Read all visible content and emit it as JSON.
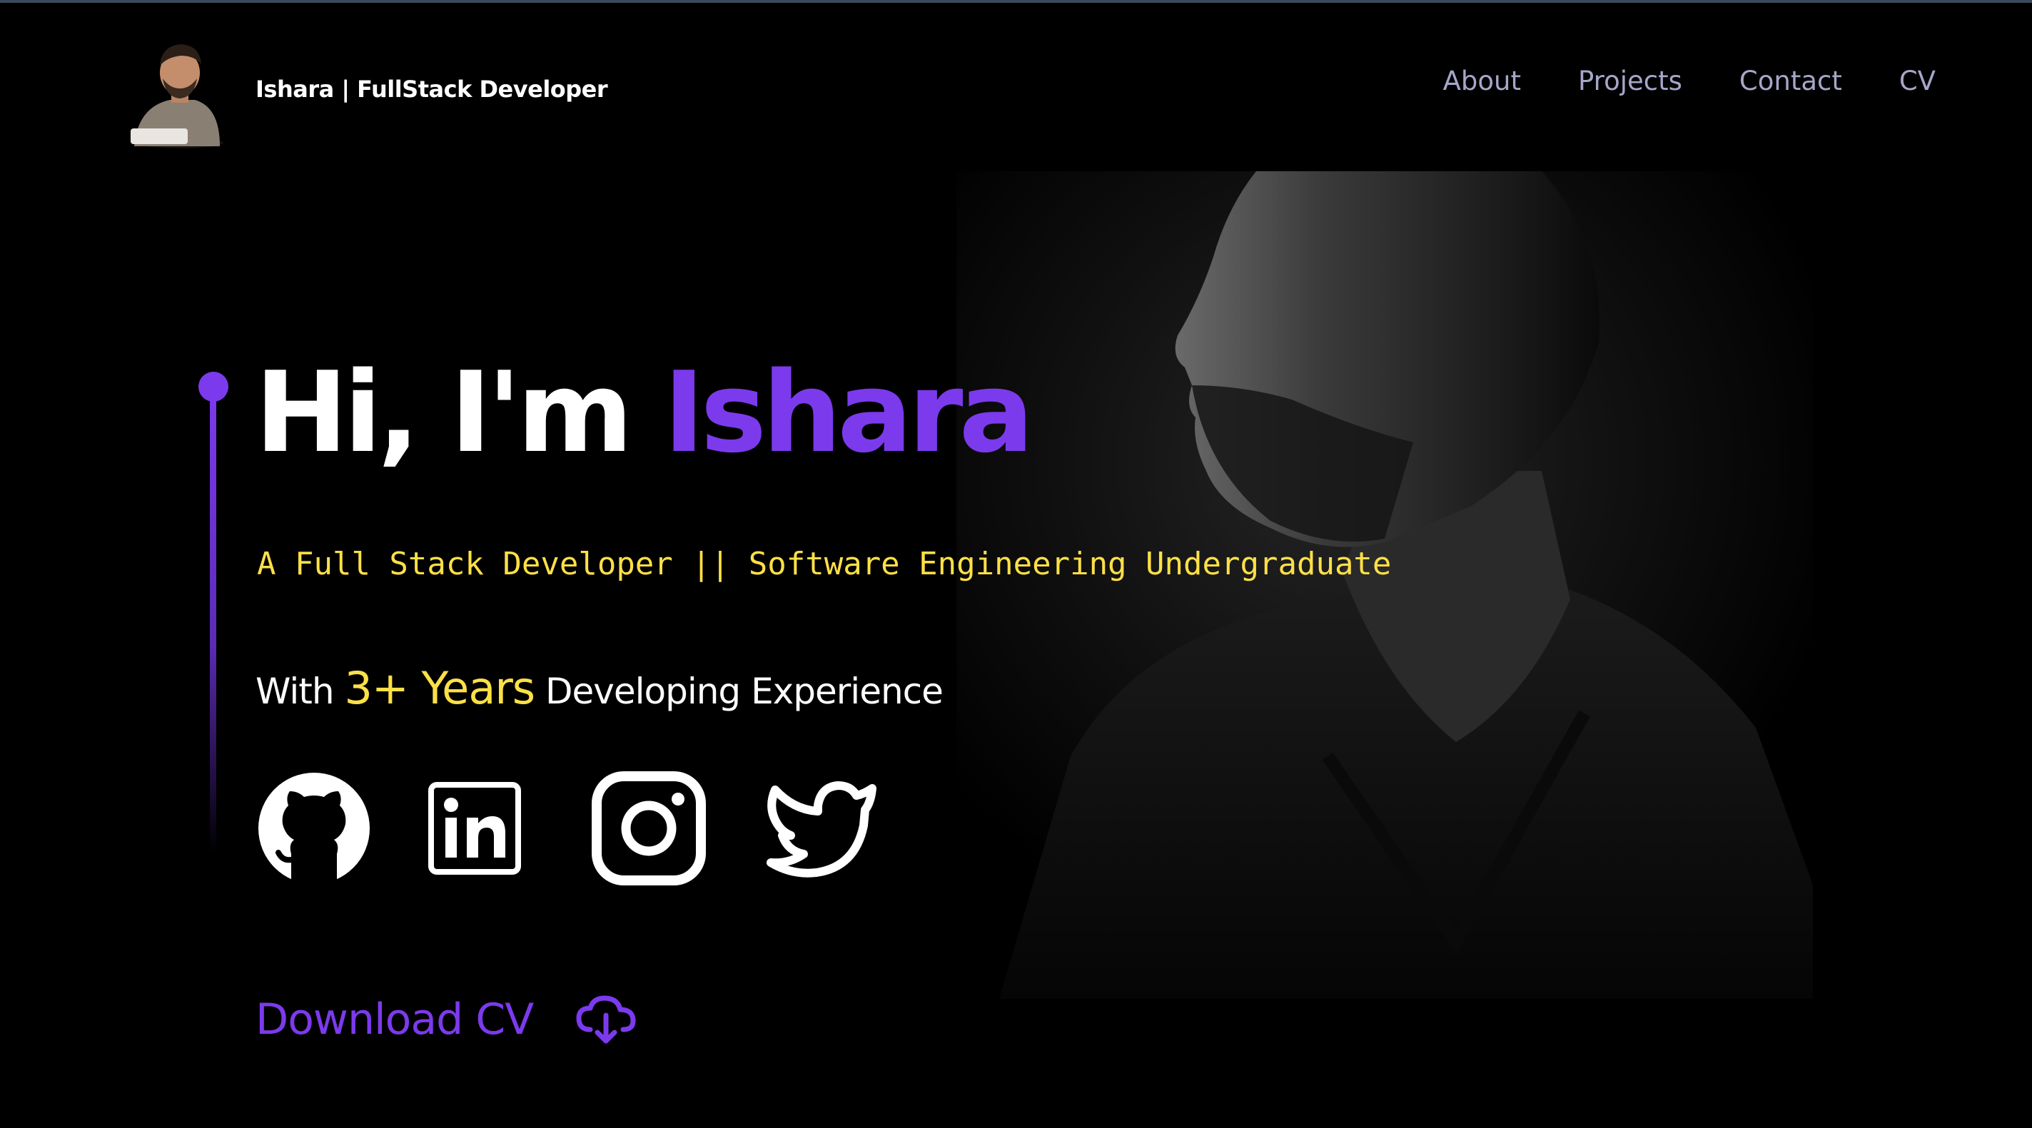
{
  "header": {
    "brand_name": "Ishara | FullStack Developer",
    "nav": [
      {
        "label": "About"
      },
      {
        "label": "Projects"
      },
      {
        "label": "Contact"
      },
      {
        "label": "CV"
      }
    ]
  },
  "hero": {
    "greeting": "Hi, I'm",
    "name": "Ishara",
    "subtitle": "A Full Stack Developer || Software Engineering Undergraduate",
    "experience_prefix": "With",
    "experience_years": "3+ Years",
    "experience_suffix": "Developing Experience",
    "download_label": "Download CV"
  },
  "socials": [
    {
      "icon": "github-icon"
    },
    {
      "icon": "linkedin-icon"
    },
    {
      "icon": "instagram-icon"
    },
    {
      "icon": "twitter-icon"
    }
  ],
  "colors": {
    "accent": "#7c3aed",
    "highlight": "#fde047",
    "nav": "#a6a6c9",
    "background": "#000000"
  }
}
